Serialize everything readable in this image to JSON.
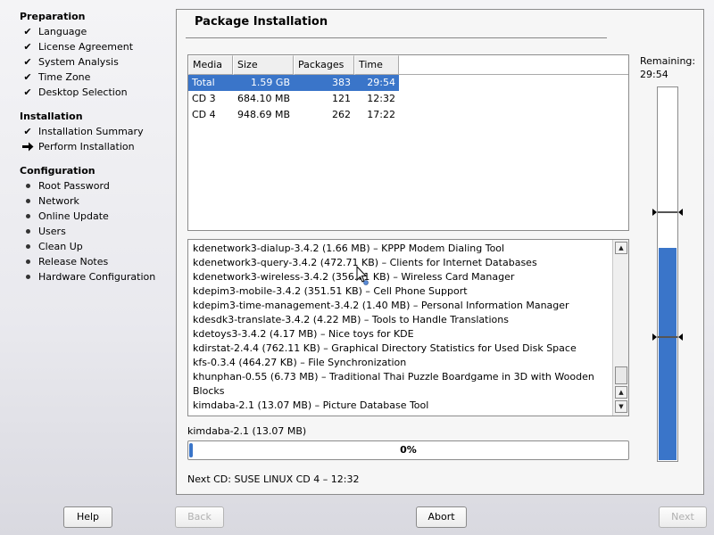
{
  "sidebar": {
    "sections": [
      {
        "title": "Preparation",
        "steps": [
          {
            "label": "Language",
            "status": "done"
          },
          {
            "label": "License Agreement",
            "status": "done"
          },
          {
            "label": "System Analysis",
            "status": "done"
          },
          {
            "label": "Time Zone",
            "status": "done"
          },
          {
            "label": "Desktop Selection",
            "status": "done"
          }
        ]
      },
      {
        "title": "Installation",
        "steps": [
          {
            "label": "Installation Summary",
            "status": "done"
          },
          {
            "label": "Perform Installation",
            "status": "current"
          }
        ]
      },
      {
        "title": "Configuration",
        "steps": [
          {
            "label": "Root Password",
            "status": "pending"
          },
          {
            "label": "Network",
            "status": "pending"
          },
          {
            "label": "Online Update",
            "status": "pending"
          },
          {
            "label": "Users",
            "status": "pending"
          },
          {
            "label": "Clean Up",
            "status": "pending"
          },
          {
            "label": "Release Notes",
            "status": "pending"
          },
          {
            "label": "Hardware Configuration",
            "status": "pending"
          }
        ]
      }
    ]
  },
  "main": {
    "title": "Package Installation",
    "table": {
      "columns": [
        "Media",
        "Size",
        "Packages",
        "Time"
      ],
      "rows": [
        {
          "media": "Total",
          "size": "1.59 GB",
          "packages": "383",
          "time": "29:54",
          "selected": true
        },
        {
          "media": "CD 3",
          "size": "684.10 MB",
          "packages": "121",
          "time": "12:32",
          "selected": false
        },
        {
          "media": "CD 4",
          "size": "948.69 MB",
          "packages": "262",
          "time": "17:22",
          "selected": false
        }
      ]
    },
    "log": [
      "kdenetwork3-dialup-3.4.2 (1.66 MB) – KPPP Modem Dialing Tool",
      "kdenetwork3-query-3.4.2 (472.71 KB) – Clients for Internet Databases",
      "kdenetwork3-wireless-3.4.2 (356.71 KB) – Wireless Card Manager",
      "kdepim3-mobile-3.4.2 (351.51 KB) – Cell Phone Support",
      "kdepim3-time-management-3.4.2 (1.40 MB) – Personal Information Manager",
      "kdesdk3-translate-3.4.2 (4.22 MB) – Tools to Handle Translations",
      "kdetoys3-3.4.2 (4.17 MB) – Nice toys for KDE",
      "kdirstat-2.4.4 (762.11 KB) – Graphical Directory Statistics for Used Disk Space",
      "kfs-0.3.4 (464.27 KB) – File Synchronization",
      "khunphan-0.55 (6.73 MB) – Traditional Thai Puzzle Boardgame in 3D with Wooden",
      "Blocks",
      "kimdaba-2.1 (13.07 MB) – Picture Database Tool"
    ],
    "current_package": "kimdaba-2.1 (13.07 MB)",
    "progress": {
      "percent": 0,
      "text": "0%"
    },
    "next_cd": "Next CD: SUSE LINUX CD 4 – 12:32",
    "remaining": {
      "label": "Remaining:",
      "time": "29:54",
      "filled_fraction": 0.57
    }
  },
  "buttons": {
    "help": "Help",
    "back": "Back",
    "abort": "Abort",
    "next": "Next"
  },
  "colors": {
    "accent": "#3a75c9"
  }
}
